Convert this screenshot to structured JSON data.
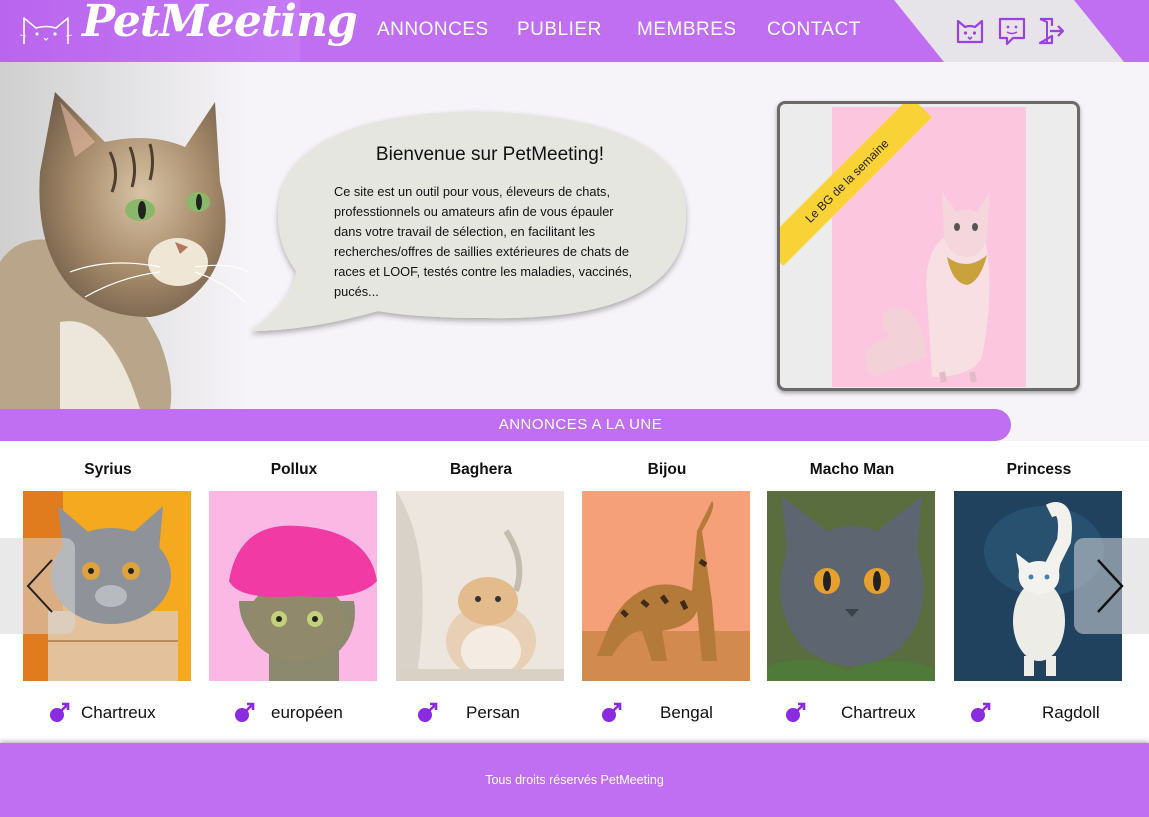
{
  "brand": {
    "name": "PetMeeting"
  },
  "nav": {
    "items": [
      {
        "label": "ANNONCES"
      },
      {
        "label": "PUBLIER"
      },
      {
        "label": "MEMBRES"
      },
      {
        "label": "CONTACT"
      }
    ]
  },
  "header_icons": [
    "cat-profile-icon",
    "chat-icon",
    "logout-icon"
  ],
  "hero": {
    "title": "Bienvenue sur PetMeeting!",
    "text": "Ce site est un outil pour vous, éleveurs de chats, professtionnels ou amateurs afin de vous épauler dans votre travail de sélection, en facilitant les recherches/offres de saillies extérieures de chats de races et LOOF, testés contre les maladies, vaccinés, pucés..."
  },
  "featured": {
    "ribbon": "Le BG de la semaine"
  },
  "section": {
    "title": "ANNONCES A LA UNE"
  },
  "cards": [
    {
      "name": "Syrius",
      "sex": "male",
      "breed": "Chartreux"
    },
    {
      "name": "Pollux",
      "sex": "male",
      "breed": "européen"
    },
    {
      "name": "Baghera",
      "sex": "male",
      "breed": "Persan"
    },
    {
      "name": "Bijou",
      "sex": "male",
      "breed": "Bengal"
    },
    {
      "name": "Macho Man",
      "sex": "male",
      "breed": "Chartreux"
    },
    {
      "name": "Princess",
      "sex": "male",
      "breed": "Ragdoll"
    }
  ],
  "footer": {
    "text": "Tous droits réservés PetMeeting"
  },
  "colors": {
    "primary": "#c06ef2",
    "male_icon": "#8a2be2",
    "ribbon": "#f9d236",
    "featured_bg": "#fcc6df"
  }
}
